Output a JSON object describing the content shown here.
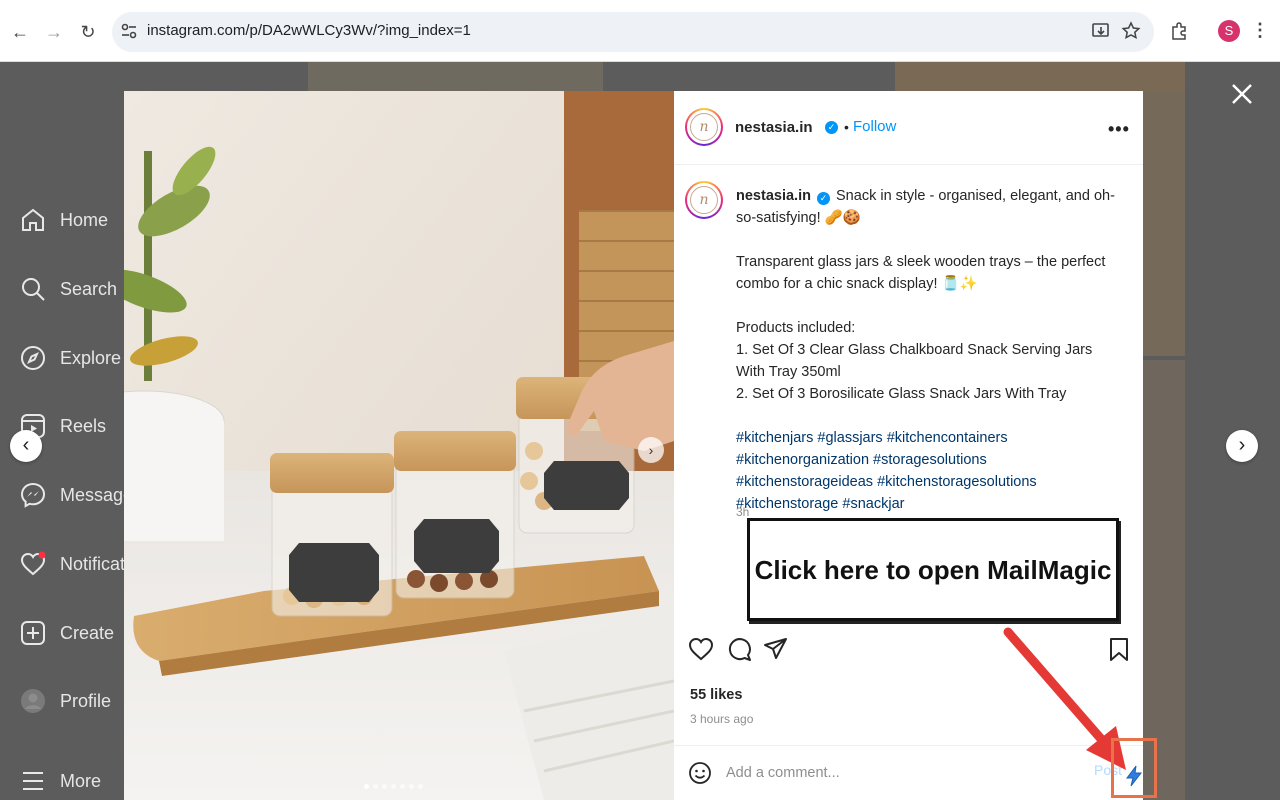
{
  "browser": {
    "url": "instagram.com/p/DA2wWLCy3Wv/?img_index=1",
    "profile_initial": "S"
  },
  "sidebar": {
    "items": [
      {
        "label": "Home",
        "icon": "home-icon"
      },
      {
        "label": "Search",
        "icon": "search-icon"
      },
      {
        "label": "Explore",
        "icon": "compass-icon"
      },
      {
        "label": "Reels",
        "icon": "reels-icon"
      },
      {
        "label": "Messages",
        "icon": "messenger-icon"
      },
      {
        "label": "Notifications",
        "icon": "heart-icon"
      },
      {
        "label": "Create",
        "icon": "plus-square-icon"
      },
      {
        "label": "Profile",
        "icon": "profile-icon"
      },
      {
        "label": "More",
        "icon": "menu-icon"
      }
    ]
  },
  "post": {
    "username": "nestasia.in",
    "follow_label": "Follow",
    "bullet": "•",
    "more_label": "•••",
    "caption_line1": "Snack in style - organised, elegant, and oh-so-satisfying! 🥜🍪",
    "caption_p2": "Transparent glass jars & sleek wooden trays – the perfect combo for a chic snack display! 🫙✨",
    "caption_p3_title": "Products included:",
    "caption_item1": "1. Set Of 3 Clear Glass Chalkboard Snack Serving Jars With Tray 350ml",
    "caption_item2": "2. Set Of 3 Borosilicate Glass Snack Jars With Tray",
    "hashtags": "#kitchenjars #glassjars #kitchencontainers #kitchenorganization #storagesolutions #kitchenstorageideas #kitchenstoragesolutions #kitchenstorage #snackjar",
    "caption_time": "3h",
    "likes": "55 likes",
    "posted_time": "3 hours ago",
    "comment_placeholder": "Add a comment...",
    "post_label": "Post",
    "image_count": 7,
    "image_index": 1
  },
  "callout": {
    "text": "Click here to open MailMagic"
  },
  "colors": {
    "link_blue": "#0095f6",
    "hashtag_blue": "#00376b",
    "callout_border": "#e8734a",
    "arrow_red": "#e53935"
  }
}
